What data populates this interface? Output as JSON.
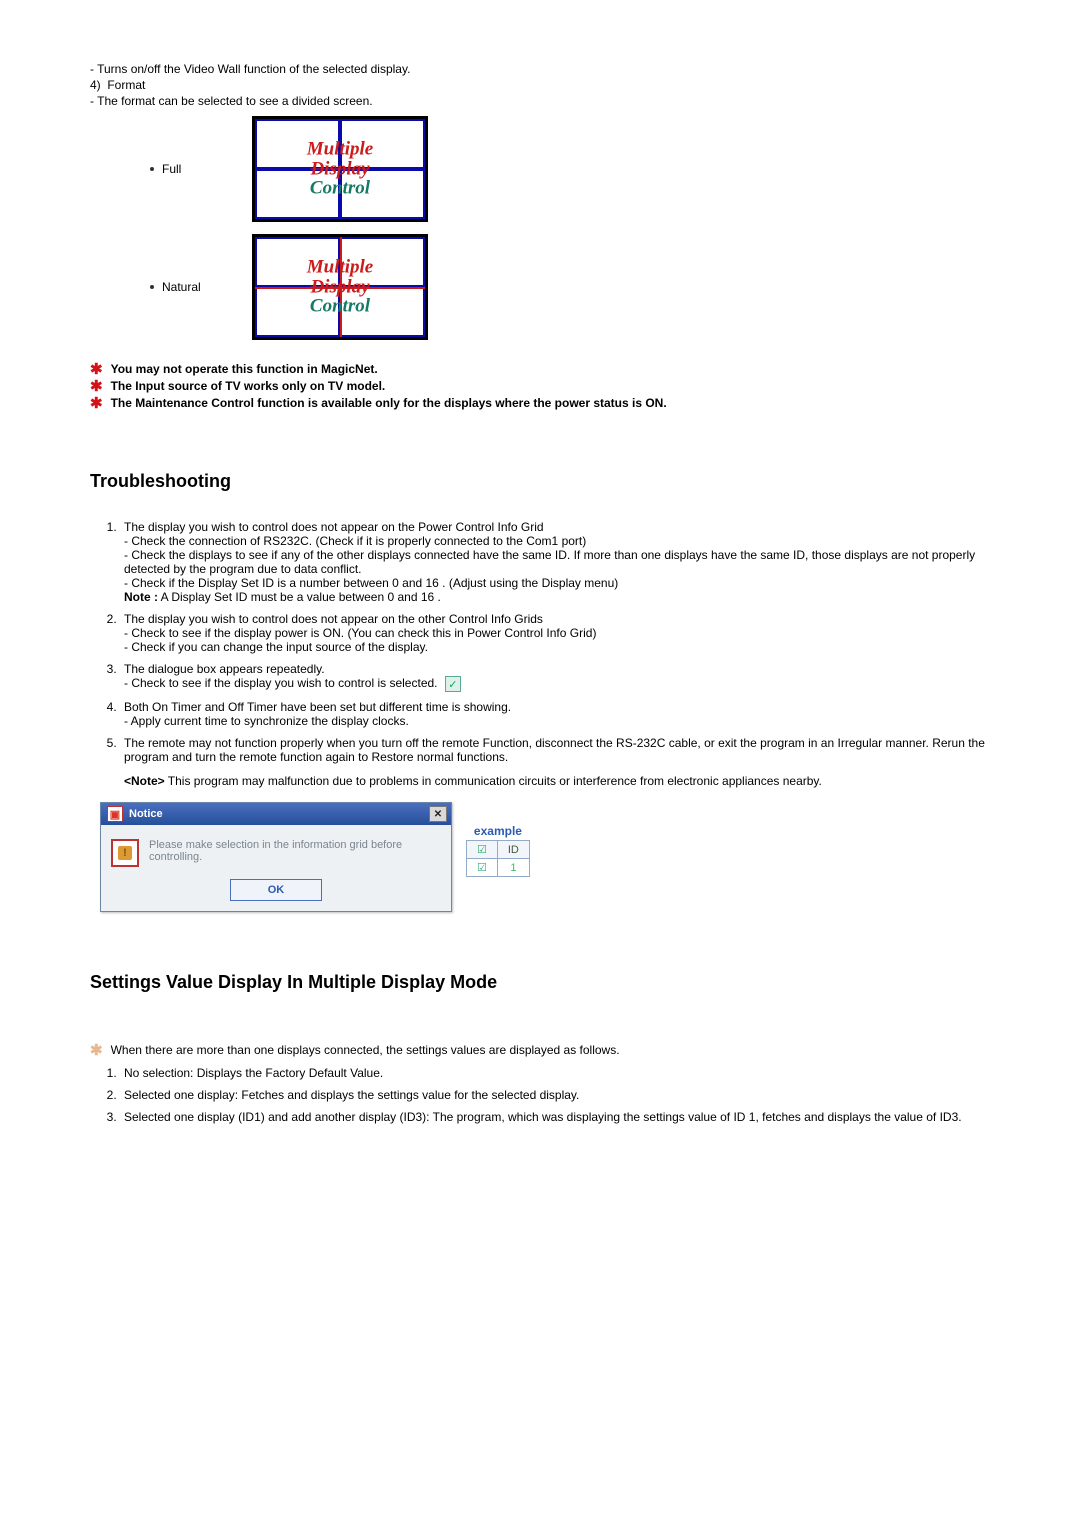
{
  "intro": {
    "video_wall_desc": "Turns on/off the Video Wall function of the selected display.",
    "format_num": "4)",
    "format_label": "Format",
    "format_desc": "The format can be selected to see a divided screen."
  },
  "format_modes": {
    "full": "Full",
    "natural": "Natural",
    "panel_line1": "Multiple",
    "panel_line2": "Display",
    "panel_line3": "Control"
  },
  "starred": [
    "You may not operate this function in MagicNet.",
    "The Input source of TV works only on TV model.",
    "The Maintenance Control function is available only for the displays where the power status is ON."
  ],
  "troubleshooting": {
    "heading": "Troubleshooting",
    "items": [
      {
        "title": "The display you wish to control does not appear on the Power Control Info Grid",
        "subs": [
          "Check the connection of RS232C. (Check if it is properly connected to the Com1 port)",
          "Check the displays to see if any of the other displays connected have the same ID. If more than one displays have the same ID, those displays are not properly detected by the program due to data conflict.",
          "Check if the Display Set ID is a number between 0 and 16 . (Adjust using the Display menu)"
        ],
        "note_prefix": "Note :",
        "note_text": "   A Display Set ID must be a value between 0 and 16 ."
      },
      {
        "title": "The display you wish to control does not appear on the other Control Info Grids",
        "subs": [
          "Check to see if the display power is ON. (You can check this in Power Control Info Grid)",
          "Check if you can change the input source of the display."
        ]
      },
      {
        "title": "The dialogue box appears repeatedly.",
        "subs": [
          "Check to see if the display you wish to control is selected."
        ],
        "has_check_glyph": true
      },
      {
        "title": "Both On Timer and Off Timer have been set but different time is showing.",
        "subs": [
          "Apply current time to synchronize the display clocks."
        ]
      },
      {
        "title": "The remote may not function properly when you turn off the remote Function, disconnect the RS-232C cable, or exit the program in an Irregular manner. Rerun the program and turn the remote function again to Restore normal functions.",
        "note_prefix": "<Note>",
        "note_text": " This program may malfunction due to problems in communication circuits or interference from electronic appliances nearby."
      }
    ]
  },
  "notice": {
    "title": "Notice",
    "message": "Please make selection in the information grid before controlling.",
    "ok": "OK",
    "example_label": "example",
    "id_header": "ID",
    "id_value": "1"
  },
  "multi": {
    "heading": "Settings Value Display In Multiple Display Mode",
    "star_line": "When there are more than one displays connected, the settings values are displayed as follows.",
    "items": [
      "No selection: Displays the Factory Default Value.",
      "Selected one display: Fetches and displays the settings value for the selected display.",
      "Selected one display (ID1) and add another display (ID3): The program, which was displaying the settings value of ID 1, fetches and displays the value of ID3."
    ]
  }
}
